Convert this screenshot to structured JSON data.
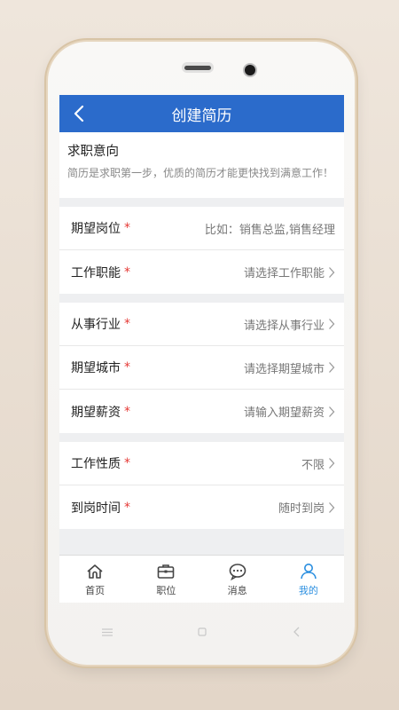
{
  "header": {
    "title": "创建简历",
    "back_icon": "chevron-left-icon"
  },
  "intro": {
    "heading": "求职意向",
    "description": "简历是求职第一步，优质的简历才能更快找到满意工作！"
  },
  "required_mark": "*",
  "groups": [
    [
      {
        "label": "期望岗位",
        "value": "比如：销售总监,销售经理",
        "has_arrow": false
      },
      {
        "label": "工作职能",
        "value": "请选择工作职能",
        "has_arrow": true
      }
    ],
    [
      {
        "label": "从事行业",
        "value": "请选择从事行业",
        "has_arrow": true
      },
      {
        "label": "期望城市",
        "value": "请选择期望城市",
        "has_arrow": true
      },
      {
        "label": "期望薪资",
        "value": "请输入期望薪资",
        "has_arrow": true
      }
    ],
    [
      {
        "label": "工作性质",
        "value": "不限",
        "has_arrow": true
      },
      {
        "label": "到岗时间",
        "value": "随时到岗",
        "has_arrow": true
      }
    ]
  ],
  "tabbar": [
    {
      "label": "首页",
      "icon": "home-icon",
      "active": false
    },
    {
      "label": "职位",
      "icon": "briefcase-icon",
      "active": false
    },
    {
      "label": "消息",
      "icon": "chat-bubble-icon",
      "active": false
    },
    {
      "label": "我的",
      "icon": "user-icon",
      "active": true
    }
  ],
  "colors": {
    "header": "#2b6bcb",
    "required": "#e53935",
    "tab_active": "#2b8fe0"
  }
}
